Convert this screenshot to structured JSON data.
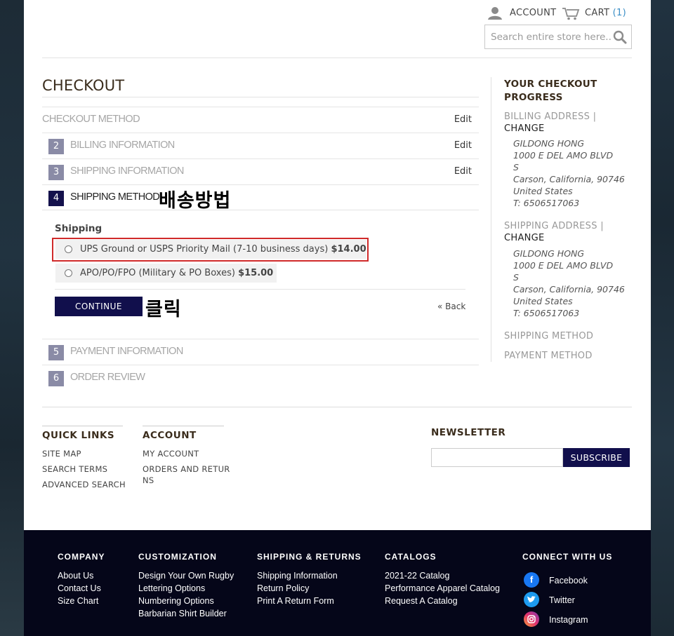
{
  "header": {
    "account_label": "ACCOUNT",
    "cart_label": "CART",
    "cart_count": "(1)",
    "search_placeholder": "Search entire store here..."
  },
  "checkout": {
    "title": "CHECKOUT",
    "steps": [
      {
        "num": "",
        "label": "CHECKOUT METHOD",
        "edit": "Edit"
      },
      {
        "num": "2",
        "label": "BILLING INFORMATION",
        "edit": "Edit"
      },
      {
        "num": "3",
        "label": "SHIPPING INFORMATION",
        "edit": "Edit"
      },
      {
        "num": "4",
        "label": "SHIPPING METHOD",
        "edit": ""
      },
      {
        "num": "5",
        "label": "PAYMENT INFORMATION",
        "edit": ""
      },
      {
        "num": "6",
        "label": "ORDER REVIEW",
        "edit": ""
      }
    ],
    "annotation_shipping": "배송방법",
    "shipping_label": "Shipping",
    "options": [
      {
        "text": "UPS Ground or USPS Priority Mail (7-10 business days)",
        "price": "$14.00"
      },
      {
        "text": "APO/PO/FPO (Military & PO Boxes)",
        "price": "$15.00"
      }
    ],
    "continue_label": "CONTINUE",
    "annotation_click": "클릭",
    "back_label": "« Back"
  },
  "progress": {
    "title": "YOUR CHECKOUT PROGRESS",
    "billing_head": "BILLING ADDRESS |",
    "change": "CHANGE",
    "billing_address": [
      "GILDONG HONG",
      "1000 E DEL AMO BLVD",
      "S",
      "Carson, California, 90746",
      "United States",
      "T: 6506517063"
    ],
    "shipping_head": "SHIPPING ADDRESS |",
    "shipping_address": [
      "GILDONG HONG",
      "1000 E DEL AMO BLVD",
      "S",
      "Carson, California, 90746",
      "United States",
      "T: 6506517063"
    ],
    "shipping_method": "SHIPPING METHOD",
    "payment_method": "PAYMENT METHOD"
  },
  "footer_links": {
    "quick_title": "QUICK LINKS",
    "quick": [
      "SITE MAP",
      "SEARCH TERMS",
      "ADVANCED SEARCH"
    ],
    "account_title": "ACCOUNT",
    "account": [
      "MY ACCOUNT",
      "ORDERS AND RETUR",
      "NS"
    ],
    "newsletter_title": "NEWSLETTER",
    "subscribe_label": "SUBSCRIBE"
  },
  "footer": {
    "company_title": "COMPANY",
    "company": [
      "About Us",
      "Contact Us",
      "Size Chart"
    ],
    "custom_title": "CUSTOMIZATION",
    "custom": [
      "Design Your Own Rugby",
      "Lettering Options",
      "Numbering Options",
      "Barbarian Shirt Builder"
    ],
    "shipping_title": "SHIPPING & RETURNS",
    "shipping": [
      "Shipping Information",
      "Return Policy",
      "Print A Return Form"
    ],
    "catalogs_title": "CATALOGS",
    "catalogs": [
      "2021-22 Catalog",
      "Performance Apparel Catalog",
      "Request A Catalog"
    ],
    "connect_title": "CONNECT WITH US",
    "social": [
      "Facebook",
      "Twitter",
      "Instagram"
    ]
  },
  "colors": {
    "accent_navy": "#110f4c",
    "highlight_red": "#d02a2a",
    "facebook": "#1877f2",
    "twitter": "#1d9bf0"
  }
}
